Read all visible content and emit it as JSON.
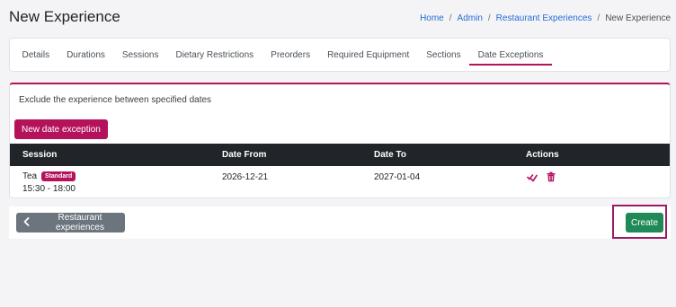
{
  "page": {
    "title": "New Experience"
  },
  "breadcrumb": [
    "Home",
    "Admin",
    "Restaurant Experiences",
    "New Experience"
  ],
  "tabs": [
    {
      "label": "Details"
    },
    {
      "label": "Durations"
    },
    {
      "label": "Sessions"
    },
    {
      "label": "Dietary Restrictions"
    },
    {
      "label": "Preorders"
    },
    {
      "label": "Required Equipment"
    },
    {
      "label": "Sections"
    },
    {
      "label": "Date Exceptions",
      "active": true
    }
  ],
  "date_exceptions": {
    "description": "Exclude the experience between specified dates",
    "new_button": "New date exception",
    "columns": [
      "Session",
      "Date From",
      "Date To",
      "Actions"
    ],
    "rows": [
      {
        "session_name": "Tea",
        "badge": "Standard",
        "time": "15:30 - 18:00",
        "date_from": "2026-12-21",
        "date_to": "2027-01-04"
      }
    ]
  },
  "footer": {
    "back_label": "Restaurant experiences",
    "create_label": "Create"
  },
  "icons": {
    "edit": "check-edit-icon",
    "delete": "trash-icon",
    "back": "chevron-left-icon"
  },
  "colors": {
    "accent": "#b5125c",
    "success": "#1f8a57",
    "secondary": "#6c757d",
    "header": "#212529",
    "link": "#2a6bd6"
  }
}
